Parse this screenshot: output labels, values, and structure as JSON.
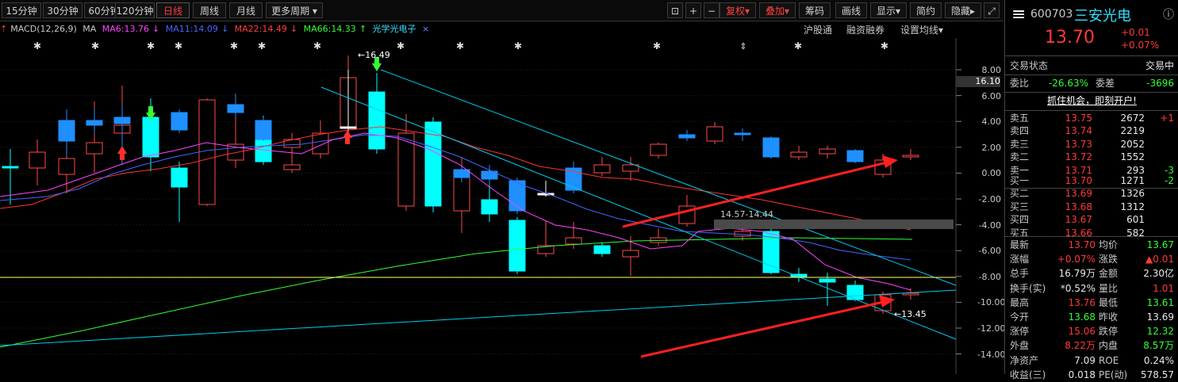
{
  "toolbar": {
    "periods": [
      "15分钟",
      "30分钟",
      "60分钟",
      "120分钟",
      "日线",
      "周线",
      "月线",
      "更多周期"
    ],
    "active_period": "日线",
    "fuquan": "复权",
    "overlay": "叠加",
    "chips": "筹码",
    "draw": "画线",
    "display": "显示",
    "simple": "简约",
    "hide": "隐藏"
  },
  "legend": {
    "macd": "MACD(12,26,9)",
    "ma": "MA",
    "ma6": "MA6:13.76",
    "ma11": "MA11:14.09",
    "ma22": "MA22:14.49",
    "ma66": "MA66:14.33",
    "sector": "光学光电子",
    "close": "×",
    "hgt": "沪股通",
    "margin": "融资融券",
    "setma": "设置均线"
  },
  "chart_data": {
    "type": "candlestick",
    "y_ticks": [
      "8.00",
      "6.00",
      "4.00",
      "2.00",
      "0.00",
      "-2.00",
      "-4.00",
      "-6.00",
      "-8.00",
      "-10.00",
      "-12.00",
      "-14.00"
    ],
    "current_label": "16.10",
    "high_label": "16.49",
    "low_label": "13.45",
    "range_label": "14.57-14.44"
  },
  "panel": {
    "code": "600703",
    "name": "三安光电",
    "price": "13.70",
    "change": "+0.01",
    "change_pct": "+0.07%",
    "trade_status_label": "交易状态",
    "trade_status": "交易中",
    "weibi_label": "委比",
    "weibi": "-26.63%",
    "weicha_label": "委差",
    "weicha": "-3696",
    "banner": "抓住机会，即刻开户!",
    "asks": [
      {
        "label": "卖五",
        "price": "13.75",
        "vol": "2672",
        "chg": "+1"
      },
      {
        "label": "卖四",
        "price": "13.74",
        "vol": "2219",
        "chg": ""
      },
      {
        "label": "卖三",
        "price": "13.73",
        "vol": "2052",
        "chg": ""
      },
      {
        "label": "卖二",
        "price": "13.72",
        "vol": "1552",
        "chg": ""
      },
      {
        "label": "卖一",
        "price": "13.71",
        "vol": "293",
        "chg": "-3"
      }
    ],
    "bids": [
      {
        "label": "买一",
        "price": "13.70",
        "vol": "1271",
        "chg": "-2"
      },
      {
        "label": "买二",
        "price": "13.69",
        "vol": "1326",
        "chg": ""
      },
      {
        "label": "买三",
        "price": "13.68",
        "vol": "1312",
        "chg": ""
      },
      {
        "label": "买四",
        "price": "13.67",
        "vol": "601",
        "chg": ""
      },
      {
        "label": "买五",
        "price": "13.66",
        "vol": "582",
        "chg": ""
      }
    ],
    "stats": [
      {
        "l1": "最新",
        "v1": "13.70",
        "c1": "red",
        "l2": "均价",
        "v2": "13.67",
        "c2": "grn"
      },
      {
        "l1": "涨幅",
        "v1": "+0.07%",
        "c1": "red",
        "l2": "涨跌",
        "v2": "▲0.01",
        "c2": "red"
      },
      {
        "l1": "总手",
        "v1": "16.79万",
        "c1": "wht",
        "l2": "金额",
        "v2": "2.30亿",
        "c2": "wht"
      },
      {
        "l1": "换手(实)",
        "v1": "*0.52%",
        "c1": "wht",
        "l2": "量比",
        "v2": "1.01",
        "c2": "red"
      },
      {
        "l1": "最高",
        "v1": "13.76",
        "c1": "red",
        "l2": "最低",
        "v2": "13.61",
        "c2": "grn"
      },
      {
        "l1": "今开",
        "v1": "13.68",
        "c1": "grn",
        "l2": "昨收",
        "v2": "13.69",
        "c2": "wht"
      },
      {
        "l1": "涨停",
        "v1": "15.06",
        "c1": "red",
        "l2": "跌停",
        "v2": "12.32",
        "c2": "grn"
      },
      {
        "l1": "外盘",
        "v1": "8.22万",
        "c1": "red",
        "l2": "内盘",
        "v2": "8.57万",
        "c2": "grn"
      },
      {
        "l1": "净资产",
        "v1": "7.09",
        "c1": "wht",
        "l2": "ROE",
        "v2": "0.24%",
        "c2": "wht"
      },
      {
        "l1": "收益(三)",
        "v1": "0.018",
        "c1": "wht",
        "l2": "PE(动)",
        "v2": "578.57",
        "c2": "wht"
      }
    ]
  }
}
